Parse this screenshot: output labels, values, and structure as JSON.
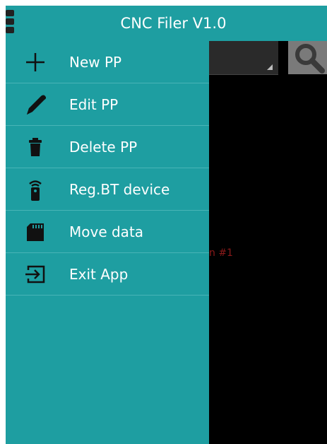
{
  "app": {
    "title": "CNC Filer V1.0"
  },
  "drawer": {
    "items": [
      {
        "label": "New PP",
        "icon": "plus-icon"
      },
      {
        "label": "Edit PP",
        "icon": "pencil-icon"
      },
      {
        "label": "Delete PP",
        "icon": "trash-icon"
      },
      {
        "label": "Reg.BT device",
        "icon": "remote-signal-icon"
      },
      {
        "label": "Move data",
        "icon": "sd-card-icon"
      },
      {
        "label": "Exit App",
        "icon": "exit-icon"
      }
    ]
  },
  "background": {
    "partial_text": "n #1"
  },
  "colors": {
    "teal": "#1e9ea1",
    "divider": "#48b4b6",
    "content_bg": "#000000",
    "search_button": "#7a7a7a",
    "behind_text": "#8a1a1a"
  }
}
